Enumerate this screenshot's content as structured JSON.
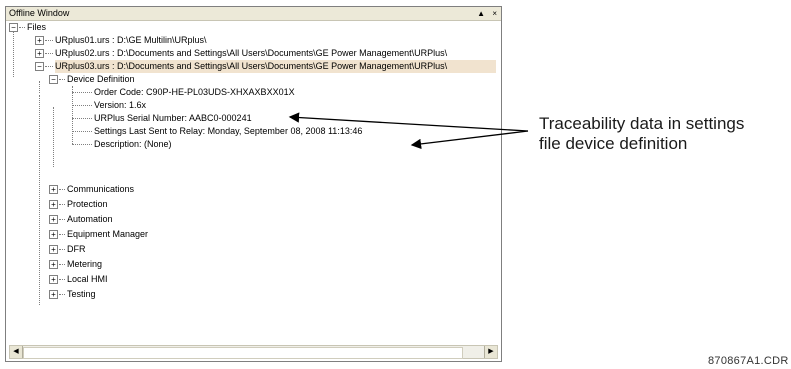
{
  "window": {
    "title": "Offline Window",
    "pin_icon": "▲",
    "close_icon": "×"
  },
  "tree": {
    "root": "Files",
    "files": [
      "URplus01.urs : D:\\GE Multilin\\URplus\\",
      "URplus02.urs : D:\\Documents and Settings\\All Users\\Documents\\GE Power Management\\URPlus\\",
      "URplus03.urs : D:\\Documents and Settings\\All Users\\Documents\\GE Power Management\\URPlus\\"
    ],
    "device_definition": "Device Definition",
    "device_items": [
      "Order Code: C90P-HE-PL03UDS-XHXAXBXX01X",
      "Version: 1.6x",
      "URPlus Serial Number: AABC0-000241",
      "Settings Last Sent to Relay:  Monday, September 08, 2008 11:13:46",
      "Description: (None)"
    ],
    "sections": [
      "Communications",
      "Protection",
      "Automation",
      "Equipment Manager",
      "DFR",
      "Metering",
      "Local HMI",
      "Testing"
    ]
  },
  "annotation": {
    "line1": "Traceability data in settings",
    "line2": "file device definition"
  },
  "figure_code": "870867A1.CDR",
  "colors": {
    "highlight": "#f1e3cf",
    "tree_line": "#808080"
  }
}
